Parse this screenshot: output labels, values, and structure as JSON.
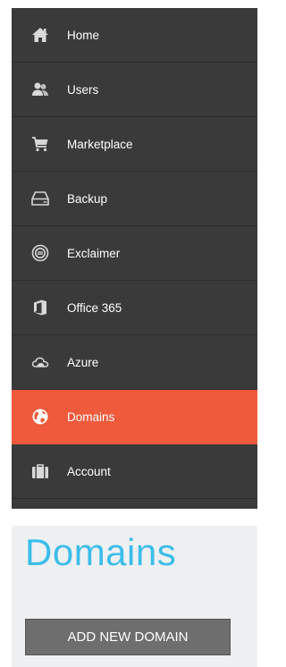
{
  "sidebar": {
    "items": [
      {
        "label": "Home",
        "icon": "home-icon"
      },
      {
        "label": "Users",
        "icon": "users-icon"
      },
      {
        "label": "Marketplace",
        "icon": "cart-icon"
      },
      {
        "label": "Backup",
        "icon": "hard-drive-icon"
      },
      {
        "label": "Exclaimer",
        "icon": "exclaimer-icon"
      },
      {
        "label": "Office 365",
        "icon": "office-icon"
      },
      {
        "label": "Azure",
        "icon": "cloud-icon"
      },
      {
        "label": "Domains",
        "icon": "globe-icon",
        "active": true
      },
      {
        "label": "Account",
        "icon": "briefcase-icon"
      }
    ]
  },
  "main": {
    "title": "Domains",
    "add_button_label": "ADD NEW DOMAIN"
  },
  "colors": {
    "sidebar_bg": "#3a3a3a",
    "active_item": "#f05a3c",
    "title": "#3cbde9",
    "button_bg": "#6e6e6e"
  }
}
